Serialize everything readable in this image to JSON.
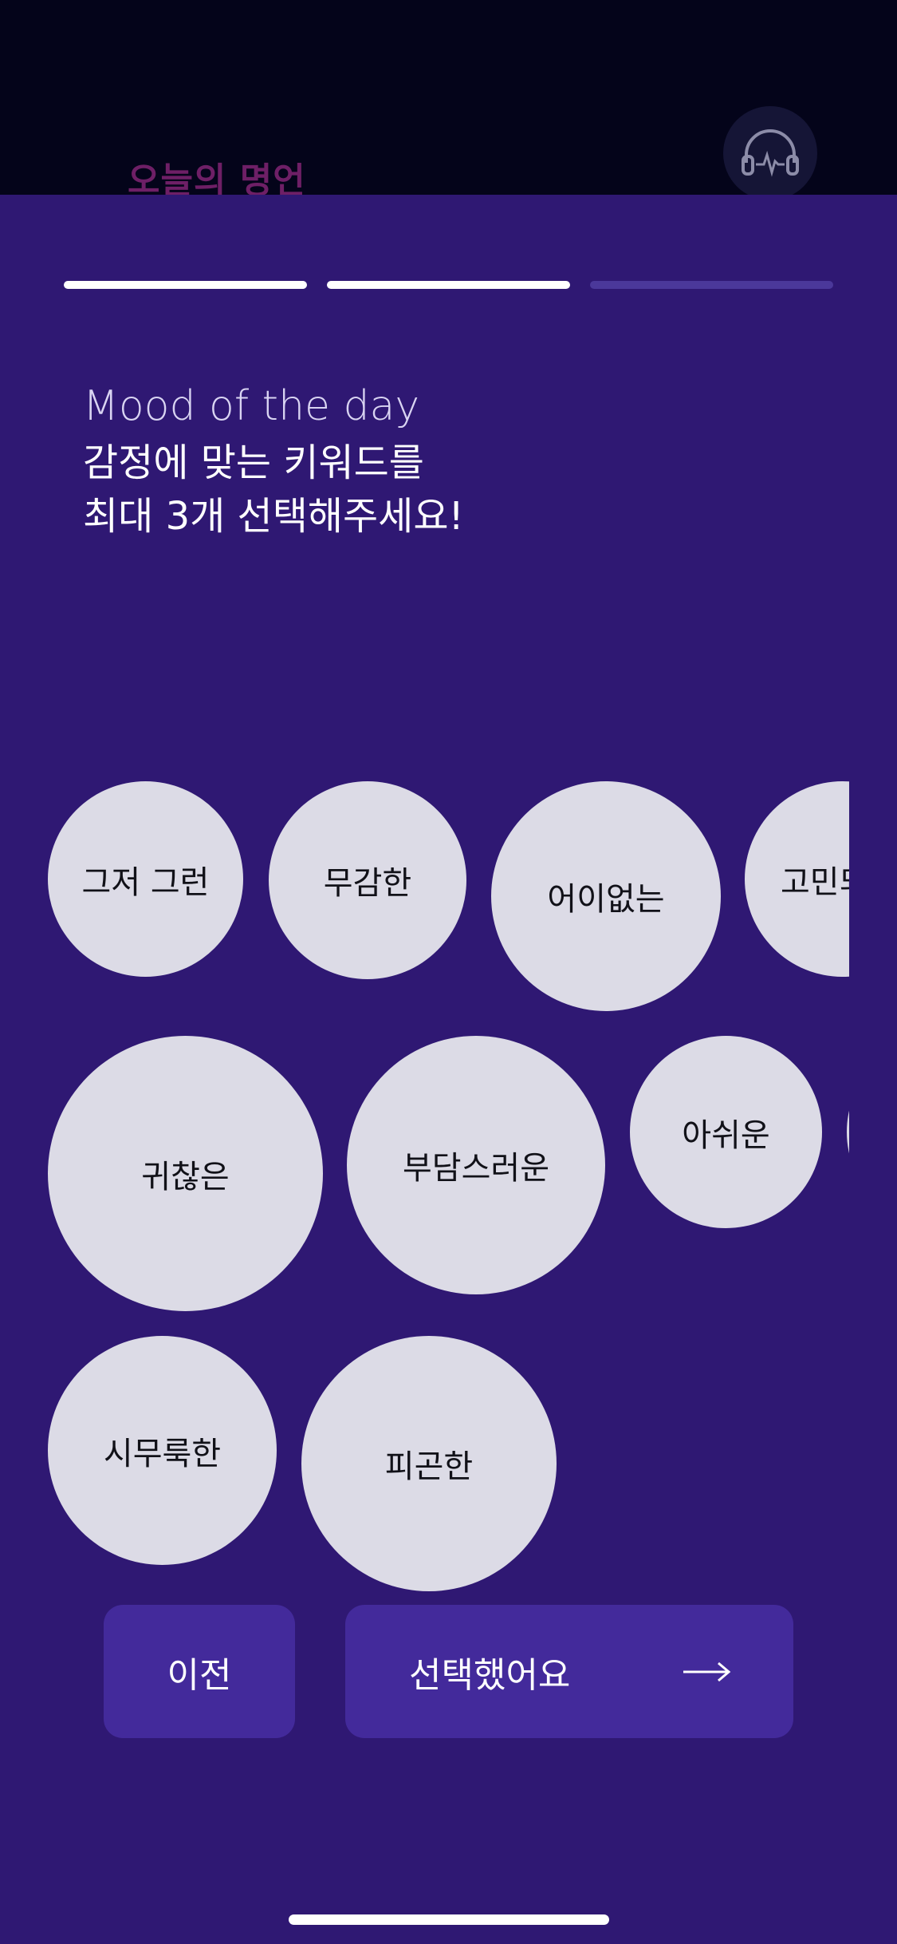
{
  "background": {
    "title": "오늘의 명언",
    "headphone_icon": "headphone-icon"
  },
  "colors": {
    "sheet": "#2f1873",
    "bubble": "#dcdbe6",
    "button": "#432a9b",
    "progress_active": "#ffffff",
    "progress_inactive": "#4b389a"
  },
  "progress": {
    "current_step": 2,
    "total_steps": 3
  },
  "header": {
    "subtitle": "Mood of the day",
    "headline_line1": "감정에 맞는 키워드를",
    "headline_line2": "최대 3개 선택해주세요!"
  },
  "keywords": [
    "그저 그런",
    "무감한",
    "어이없는",
    "고민되는",
    "귀찮은",
    "부담스러운",
    "아쉬운",
    "",
    "시무룩한",
    "피곤한"
  ],
  "buttons": {
    "prev_label": "이전",
    "next_label": "선택했어요",
    "next_icon": "arrow-right-icon"
  }
}
